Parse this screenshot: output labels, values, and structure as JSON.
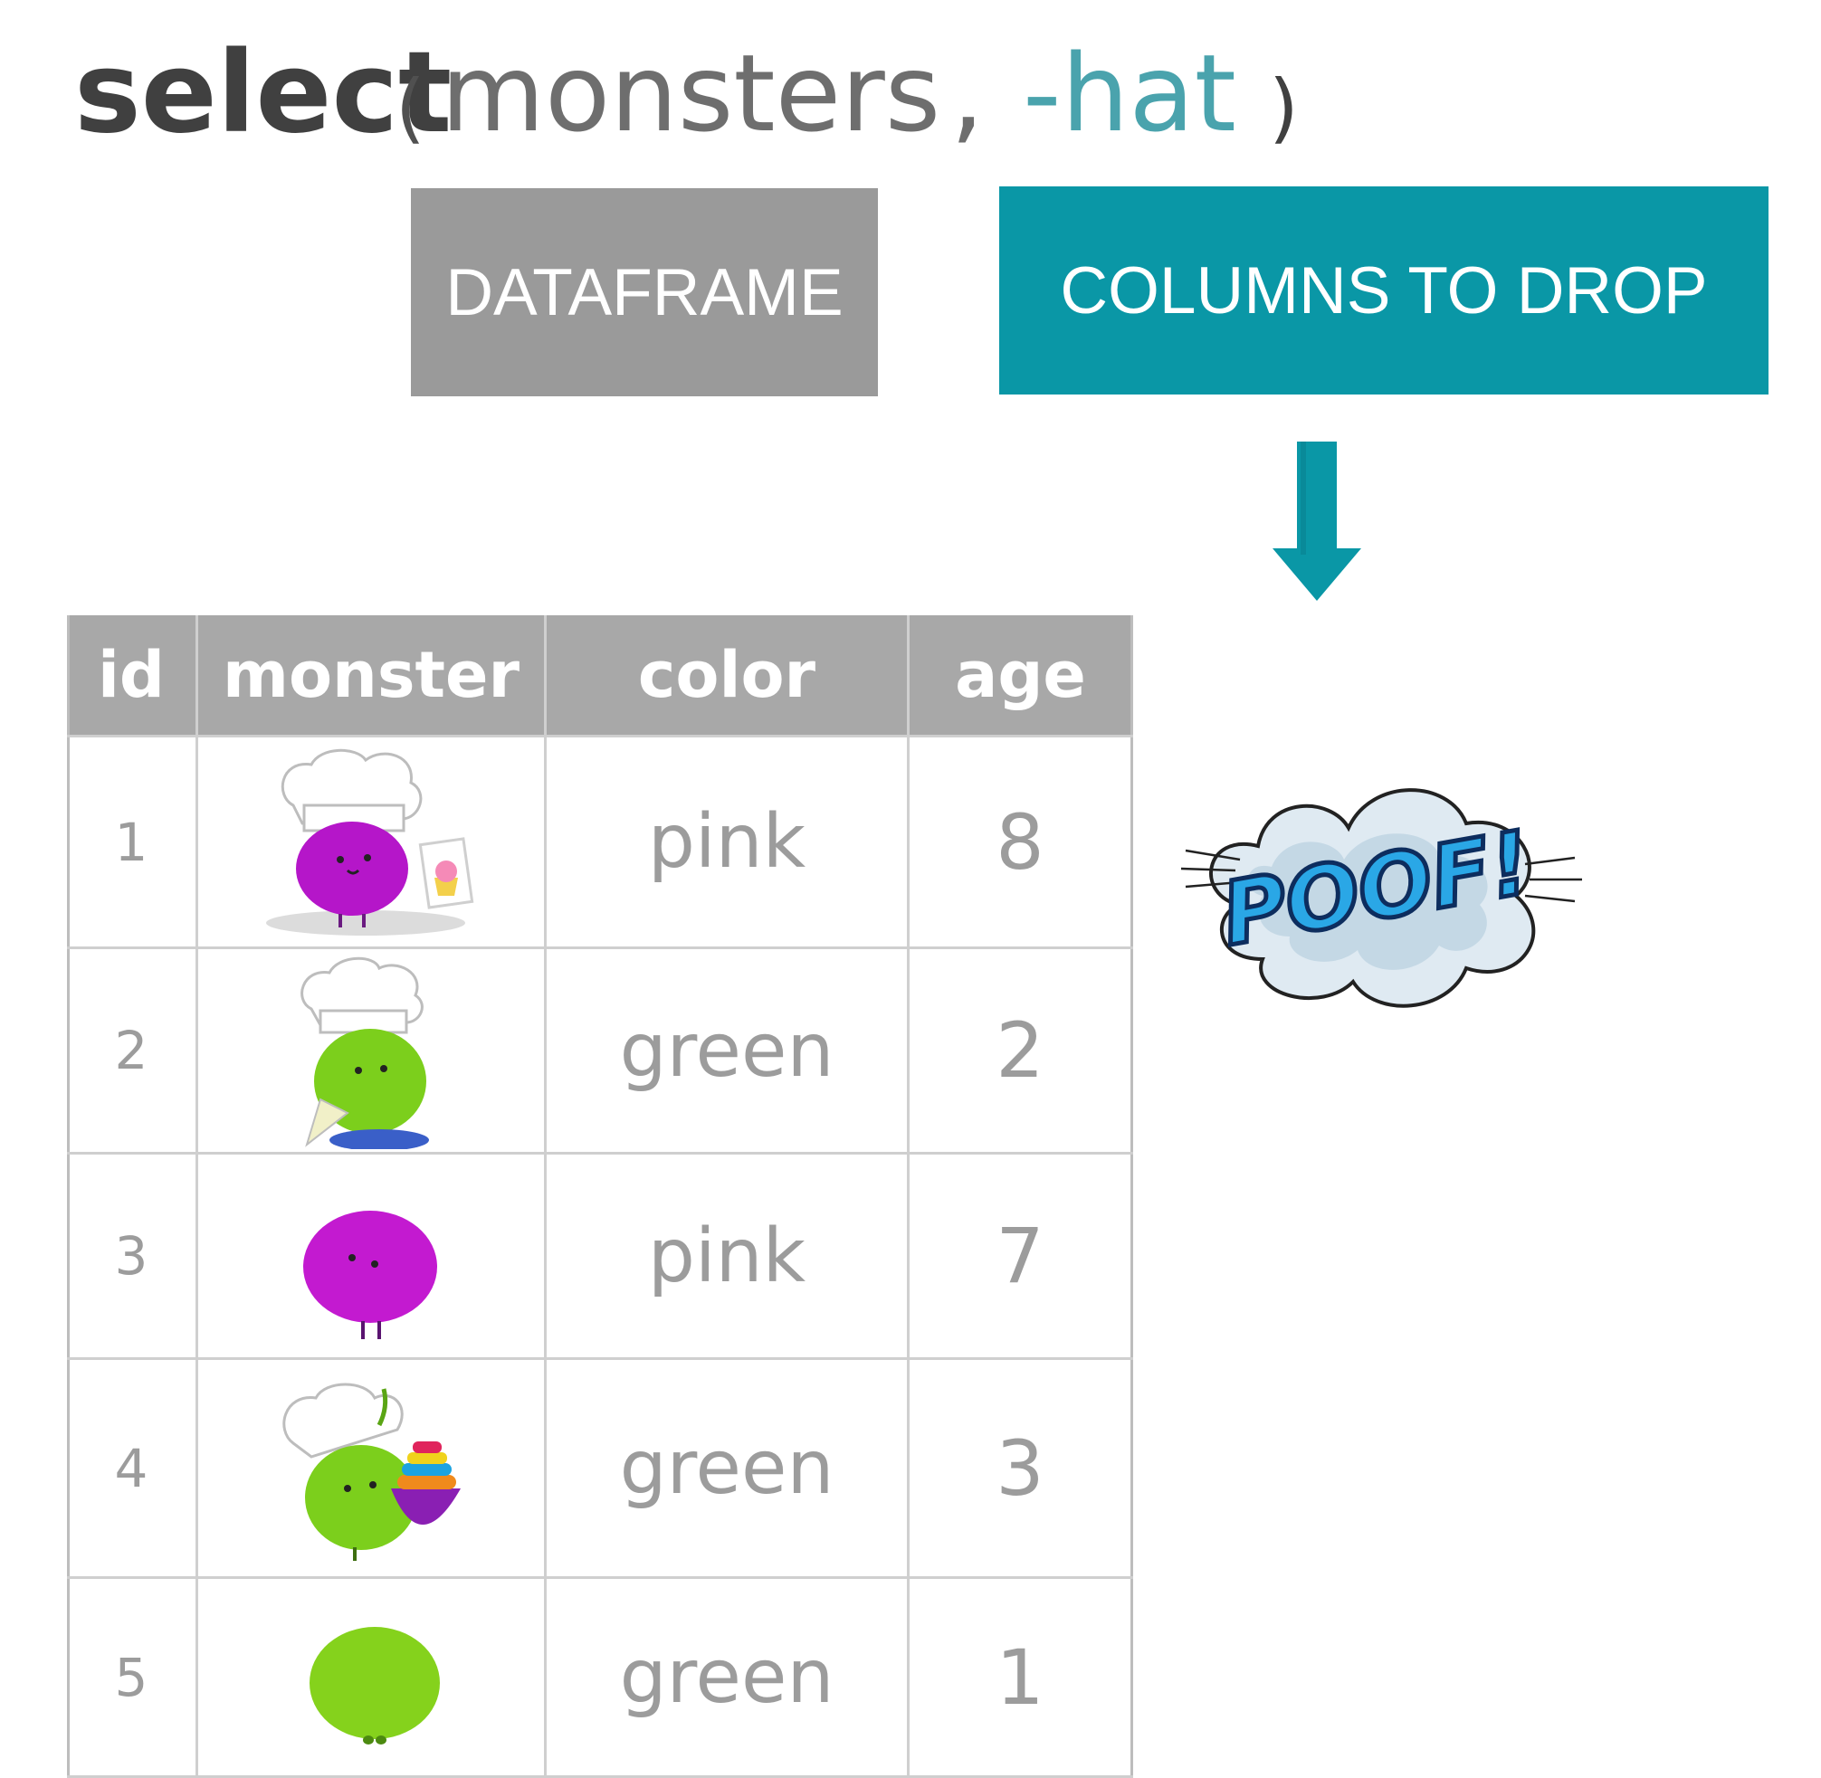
{
  "code": {
    "function": "select",
    "open_paren": "(",
    "arg_dataframe": "monsters",
    "comma": ",",
    "arg_columns": "-hat",
    "close_paren": ")"
  },
  "labels": {
    "dataframe": "DATAFRAME",
    "columns_to_drop": "COLUMNS TO DROP"
  },
  "colors": {
    "teal": "#0a97a6",
    "gray_box": "#9a9a9a",
    "header_gray": "#a8a8a8",
    "cell_text": "#9c9c9c",
    "pink_monster": "#b516c9",
    "green_monster": "#7ccf1c"
  },
  "table": {
    "headers": [
      "id",
      "monster",
      "color",
      "age"
    ],
    "rows": [
      {
        "id": "1",
        "monster": "pink-chef-monster-with-cupcake",
        "color": "pink",
        "age": "8"
      },
      {
        "id": "2",
        "monster": "green-chef-monster-with-piping-bag",
        "color": "green",
        "age": "2"
      },
      {
        "id": "3",
        "monster": "pink-monster",
        "color": "pink",
        "age": "7"
      },
      {
        "id": "4",
        "monster": "green-chef-monster-with-bowls",
        "color": "green",
        "age": "3"
      },
      {
        "id": "5",
        "monster": "green-monster",
        "color": "green",
        "age": "1"
      }
    ]
  },
  "poof": {
    "text": "POOF!",
    "icon": "poof-cloud-icon"
  }
}
